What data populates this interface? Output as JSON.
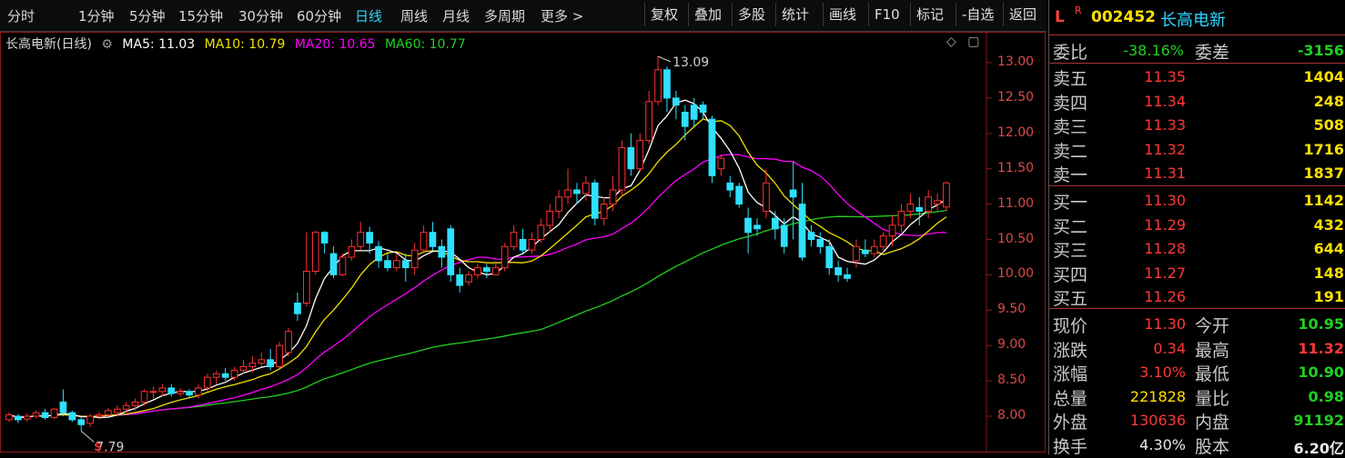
{
  "toolbar": {
    "periods": [
      "分时",
      "1分钟",
      "5分钟",
      "15分钟",
      "30分钟",
      "60分钟",
      "日线",
      "周线",
      "月线",
      "多周期",
      "更多 >"
    ],
    "active_period": "日线",
    "buttons": [
      "复权",
      "叠加",
      "多股",
      "统计",
      "画线",
      "F10",
      "标记",
      "-自选",
      "返回"
    ]
  },
  "legend": {
    "title": "长高电新(日线)",
    "ma5": "MA5: 11.03",
    "ma10": "MA10: 10.79",
    "ma20": "MA20: 10.65",
    "ma60": "MA60: 10.77"
  },
  "colors": {
    "up": "#ff3030",
    "down": "#2fe0ff",
    "ma5": "#ffffff",
    "ma10": "#f0e000",
    "ma20": "#ff00ff",
    "ma60": "#20d020"
  },
  "icons": {
    "diamond": "◇",
    "window": "▢"
  },
  "annotations": {
    "high": "13.09",
    "low": "7.79",
    "marker": "S"
  },
  "chart_data": {
    "type": "candlestick",
    "y_ticks": [
      "13.00",
      "12.50",
      "12.00",
      "11.50",
      "11.00",
      "10.50",
      "10.00",
      "9.50",
      "9.00",
      "8.50",
      "8.00"
    ],
    "ylim": [
      7.6,
      13.3
    ],
    "candles": [
      [
        7.95,
        8.02,
        7.92,
        8.05
      ],
      [
        8.0,
        7.95,
        7.9,
        8.03
      ],
      [
        7.96,
        8.0,
        7.92,
        8.04
      ],
      [
        8.0,
        8.05,
        7.97,
        8.08
      ],
      [
        8.05,
        7.98,
        7.95,
        8.1
      ],
      [
        7.98,
        8.1,
        7.96,
        8.12
      ],
      [
        8.2,
        8.05,
        8.0,
        8.38
      ],
      [
        8.05,
        7.95,
        7.92,
        8.08
      ],
      [
        7.95,
        7.88,
        7.79,
        7.98
      ],
      [
        7.9,
        8.0,
        7.85,
        8.03
      ],
      [
        8.0,
        8.02,
        7.95,
        8.06
      ],
      [
        8.02,
        8.08,
        8.0,
        8.12
      ],
      [
        8.05,
        8.1,
        8.0,
        8.15
      ],
      [
        8.1,
        8.15,
        8.05,
        8.2
      ],
      [
        8.15,
        8.2,
        8.08,
        8.25
      ],
      [
        8.2,
        8.35,
        8.15,
        8.38
      ],
      [
        8.35,
        8.35,
        8.25,
        8.42
      ],
      [
        8.35,
        8.4,
        8.28,
        8.45
      ],
      [
        8.4,
        8.32,
        8.28,
        8.45
      ],
      [
        8.32,
        8.35,
        8.28,
        8.4
      ],
      [
        8.35,
        8.3,
        8.25,
        8.38
      ],
      [
        8.3,
        8.4,
        8.25,
        8.45
      ],
      [
        8.4,
        8.55,
        8.35,
        8.6
      ],
      [
        8.55,
        8.6,
        8.45,
        8.65
      ],
      [
        8.6,
        8.55,
        8.5,
        8.68
      ],
      [
        8.55,
        8.65,
        8.5,
        8.7
      ],
      [
        8.65,
        8.7,
        8.6,
        8.8
      ],
      [
        8.7,
        8.75,
        8.62,
        8.85
      ],
      [
        8.75,
        8.8,
        8.7,
        8.9
      ],
      [
        8.8,
        8.7,
        8.65,
        8.95
      ],
      [
        8.7,
        9.0,
        8.68,
        9.05
      ],
      [
        8.9,
        9.2,
        8.85,
        9.25
      ],
      [
        9.6,
        9.45,
        9.35,
        9.75
      ],
      [
        9.6,
        10.05,
        9.55,
        10.6
      ],
      [
        10.05,
        10.6,
        10.0,
        10.62
      ],
      [
        10.6,
        10.45,
        10.3,
        10.62
      ],
      [
        10.3,
        10.0,
        9.95,
        10.4
      ],
      [
        10.0,
        10.25,
        9.98,
        10.3
      ],
      [
        10.25,
        10.4,
        10.2,
        10.5
      ],
      [
        10.4,
        10.6,
        10.35,
        10.75
      ],
      [
        10.6,
        10.45,
        10.3,
        10.68
      ],
      [
        10.4,
        10.2,
        10.1,
        10.48
      ],
      [
        10.2,
        10.1,
        10.05,
        10.3
      ],
      [
        10.1,
        10.2,
        10.05,
        10.3
      ],
      [
        10.2,
        10.1,
        9.9,
        10.3
      ],
      [
        10.1,
        10.35,
        10.0,
        10.45
      ],
      [
        10.35,
        10.6,
        10.3,
        10.7
      ],
      [
        10.6,
        10.4,
        10.35,
        10.75
      ],
      [
        10.4,
        10.25,
        10.1,
        10.5
      ],
      [
        10.65,
        10.0,
        9.9,
        10.7
      ],
      [
        10.0,
        9.85,
        9.75,
        10.1
      ],
      [
        9.9,
        10.0,
        9.85,
        10.05
      ],
      [
        10.0,
        10.1,
        9.95,
        10.15
      ],
      [
        10.1,
        10.05,
        9.95,
        10.15
      ],
      [
        10.0,
        10.1,
        10.0,
        10.2
      ],
      [
        10.1,
        10.4,
        10.05,
        10.45
      ],
      [
        10.4,
        10.6,
        10.35,
        10.7
      ],
      [
        10.5,
        10.35,
        10.3,
        10.65
      ],
      [
        10.35,
        10.5,
        10.3,
        10.6
      ],
      [
        10.5,
        10.7,
        10.45,
        10.8
      ],
      [
        10.7,
        10.9,
        10.6,
        11.0
      ],
      [
        10.9,
        11.1,
        10.8,
        11.2
      ],
      [
        11.1,
        11.2,
        11.0,
        11.5
      ],
      [
        11.2,
        11.15,
        11.0,
        11.3
      ],
      [
        11.15,
        11.3,
        11.05,
        11.4
      ],
      [
        11.3,
        10.8,
        10.7,
        11.35
      ],
      [
        10.8,
        11.0,
        10.7,
        11.1
      ],
      [
        11.0,
        11.2,
        10.9,
        11.4
      ],
      [
        11.2,
        11.8,
        11.1,
        11.9
      ],
      [
        11.8,
        11.5,
        11.4,
        12.0
      ],
      [
        11.5,
        11.9,
        11.45,
        12.0
      ],
      [
        11.9,
        12.45,
        11.85,
        12.6
      ],
      [
        12.45,
        12.9,
        12.4,
        13.09
      ],
      [
        12.9,
        12.5,
        12.3,
        12.95
      ],
      [
        12.5,
        12.4,
        12.2,
        12.6
      ],
      [
        12.3,
        12.1,
        11.9,
        12.4
      ],
      [
        12.4,
        12.2,
        12.1,
        12.5
      ],
      [
        12.4,
        12.3,
        12.2,
        12.45
      ],
      [
        12.2,
        11.4,
        11.3,
        12.25
      ],
      [
        11.5,
        11.65,
        11.4,
        11.7
      ],
      [
        11.3,
        11.2,
        11.1,
        11.4
      ],
      [
        11.25,
        11.0,
        10.95,
        11.3
      ],
      [
        10.8,
        10.6,
        10.3,
        10.95
      ],
      [
        10.7,
        10.65,
        10.55,
        10.8
      ],
      [
        10.9,
        11.3,
        10.8,
        11.5
      ],
      [
        10.8,
        10.65,
        10.5,
        10.9
      ],
      [
        10.7,
        10.4,
        10.3,
        10.8
      ],
      [
        11.2,
        11.1,
        10.5,
        11.6
      ],
      [
        11.0,
        10.25,
        10.2,
        11.3
      ],
      [
        10.6,
        10.5,
        10.4,
        10.7
      ],
      [
        10.5,
        10.4,
        10.3,
        10.6
      ],
      [
        10.4,
        10.1,
        10.0,
        10.5
      ],
      [
        10.1,
        10.0,
        9.9,
        10.2
      ],
      [
        10.0,
        9.95,
        9.9,
        10.1
      ],
      [
        10.2,
        10.4,
        10.1,
        10.5
      ],
      [
        10.35,
        10.3,
        10.25,
        10.5
      ],
      [
        10.3,
        10.4,
        10.25,
        10.5
      ],
      [
        10.4,
        10.55,
        10.3,
        10.6
      ],
      [
        10.55,
        10.7,
        10.4,
        10.85
      ],
      [
        10.7,
        10.9,
        10.6,
        11.0
      ],
      [
        10.9,
        11.0,
        10.8,
        11.15
      ],
      [
        10.95,
        10.9,
        10.7,
        11.1
      ],
      [
        10.9,
        11.1,
        10.8,
        11.2
      ],
      [
        11.0,
        11.05,
        10.9,
        11.15
      ],
      [
        10.96,
        11.3,
        10.9,
        11.32
      ]
    ]
  },
  "quote": {
    "header": {
      "l": "L",
      "r": "R",
      "code": "002452",
      "name": "长高电新"
    },
    "committee": {
      "label1": "委比",
      "val1": "-38.16%",
      "label2": "委差",
      "val2": "-3156"
    },
    "sells": [
      {
        "label": "卖五",
        "price": "11.35",
        "vol": "1404"
      },
      {
        "label": "卖四",
        "price": "11.34",
        "vol": "248"
      },
      {
        "label": "卖三",
        "price": "11.33",
        "vol": "508"
      },
      {
        "label": "卖二",
        "price": "11.32",
        "vol": "1716"
      },
      {
        "label": "卖一",
        "price": "11.31",
        "vol": "1837"
      }
    ],
    "buys": [
      {
        "label": "买一",
        "price": "11.30",
        "vol": "1142"
      },
      {
        "label": "买二",
        "price": "11.29",
        "vol": "432"
      },
      {
        "label": "买三",
        "price": "11.28",
        "vol": "644"
      },
      {
        "label": "买四",
        "price": "11.27",
        "vol": "148"
      },
      {
        "label": "买五",
        "price": "11.26",
        "vol": "191"
      }
    ],
    "stats": [
      {
        "l1": "现价",
        "v1": "11.30",
        "c1": "red",
        "l2": "今开",
        "v2": "10.95",
        "c2": "green"
      },
      {
        "l1": "涨跌",
        "v1": "0.34",
        "c1": "red",
        "l2": "最高",
        "v2": "11.32",
        "c2": "red"
      },
      {
        "l1": "涨幅",
        "v1": "3.10%",
        "c1": "red",
        "l2": "最低",
        "v2": "10.90",
        "c2": "green"
      },
      {
        "l1": "总量",
        "v1": "221828",
        "c1": "yellow",
        "l2": "量比",
        "v2": "0.98",
        "c2": "green"
      },
      {
        "l1": "外盘",
        "v1": "130636",
        "c1": "red",
        "l2": "内盘",
        "v2": "91192",
        "c2": "green"
      },
      {
        "l1": "换手",
        "v1": "4.30%",
        "c1": "white",
        "l2": "股本",
        "v2": "6.20亿",
        "c2": "white"
      }
    ]
  }
}
